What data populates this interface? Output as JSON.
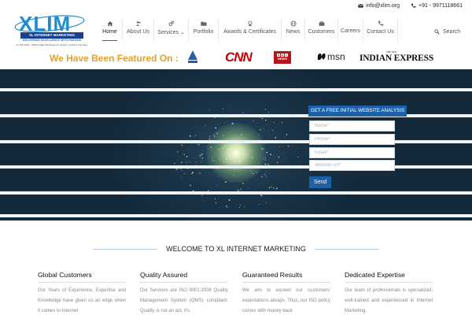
{
  "topbar": {
    "email": "info@xlim.org",
    "phone": "+91 - 9971118661"
  },
  "logo": {
    "wordmark": "XLIM",
    "subtitle": "XL INTERNET MARKETING",
    "tagline": "DELIVERING EXCELLENCE WITH PASSION",
    "certification": "An ISO 9001 : 2008 Quality Management System Certified Company"
  },
  "nav": {
    "items": [
      {
        "label": "Home",
        "icon": "home-icon",
        "active": true
      },
      {
        "label": "About Us",
        "icon": "users-icon"
      },
      {
        "label": "Services",
        "icon": "gears-icon",
        "caret": "⌄"
      },
      {
        "label": "Portfolio",
        "icon": "folder-icon"
      },
      {
        "label": "Awards & Certificates",
        "icon": "award-icon"
      },
      {
        "label": "News",
        "icon": "globe-icon"
      },
      {
        "label": "Customers",
        "icon": "briefcase-icon"
      },
      {
        "label": "Careers",
        "icon": ""
      },
      {
        "label": "Contact Us",
        "icon": "phone-icon"
      }
    ],
    "search_label": "Search"
  },
  "featured": {
    "heading": "We Have Been Featured On :",
    "brands": {
      "cnn": "CNN",
      "bbc_letters": [
        "B",
        "B",
        "C"
      ],
      "bbc_word": "NEWS",
      "msn": "msn",
      "indian_express": "INDIAN EXPRESS",
      "indian_express_small": "THE NEW"
    }
  },
  "hero": {
    "form_title": "GET A FREE INITIAL WEBSITE ANALYSIS",
    "fields": [
      {
        "name": "name",
        "placeholder": "Name*"
      },
      {
        "name": "phone",
        "placeholder": "Phone*"
      },
      {
        "name": "email",
        "placeholder": "Email*"
      },
      {
        "name": "website",
        "placeholder": "Website Url*"
      }
    ],
    "submit_label": "Send"
  },
  "welcome": {
    "heading": "WELCOME TO XL INTERNET MARKETING"
  },
  "columns": [
    {
      "title": "Global Customers",
      "text": "Our Years of Experience, Expertise and Knowledge have given us an edge when it comes to Internet"
    },
    {
      "title": "Quality Assured",
      "text": "Our Services are ISO 9001:2008 Quality Management System (QMS) compliant. Quality is not an act, it's"
    },
    {
      "title": "Guaranteed Results",
      "text": "We aim to exceed our customers' expectations always. Thus, our ISO policy comes with money back"
    },
    {
      "title": "Dedicated Expertise",
      "text": "Our team of professionals is specialized, well-trained and experienced in Internet Marketing,"
    }
  ],
  "colors": {
    "brand_blue": "#1d60a8",
    "featured_gold": "#e0a32a",
    "hero_bg": "#1b3448",
    "cnn_red": "#cc0000",
    "bbc_red": "#b8141b"
  }
}
